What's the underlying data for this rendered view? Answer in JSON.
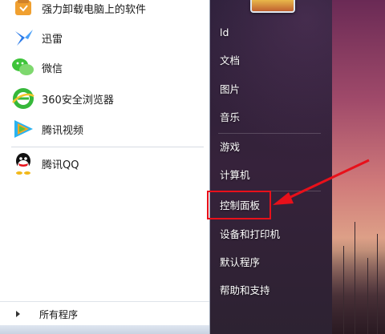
{
  "programs": [
    {
      "label": "强力卸载电脑上的软件",
      "icon": "uninstaller-icon"
    },
    {
      "label": "迅雷",
      "icon": "thunder-icon"
    },
    {
      "label": "微信",
      "icon": "wechat-icon"
    },
    {
      "label": "360安全浏览器",
      "icon": "360-browser-icon"
    },
    {
      "label": "腾讯视频",
      "icon": "tencent-video-icon"
    },
    {
      "label": "腾讯QQ",
      "icon": "qq-icon"
    }
  ],
  "all_programs_label": "所有程序",
  "right_items": [
    {
      "label": "ld"
    },
    {
      "label": "文档"
    },
    {
      "label": "图片"
    },
    {
      "label": "音乐"
    },
    {
      "label": "游戏"
    },
    {
      "label": "计算机"
    },
    {
      "label": "控制面板"
    },
    {
      "label": "设备和打印机"
    },
    {
      "label": "默认程序"
    },
    {
      "label": "帮助和支持"
    }
  ],
  "colors": {
    "highlight": "#e8101a",
    "arrow": "#e8101a"
  }
}
